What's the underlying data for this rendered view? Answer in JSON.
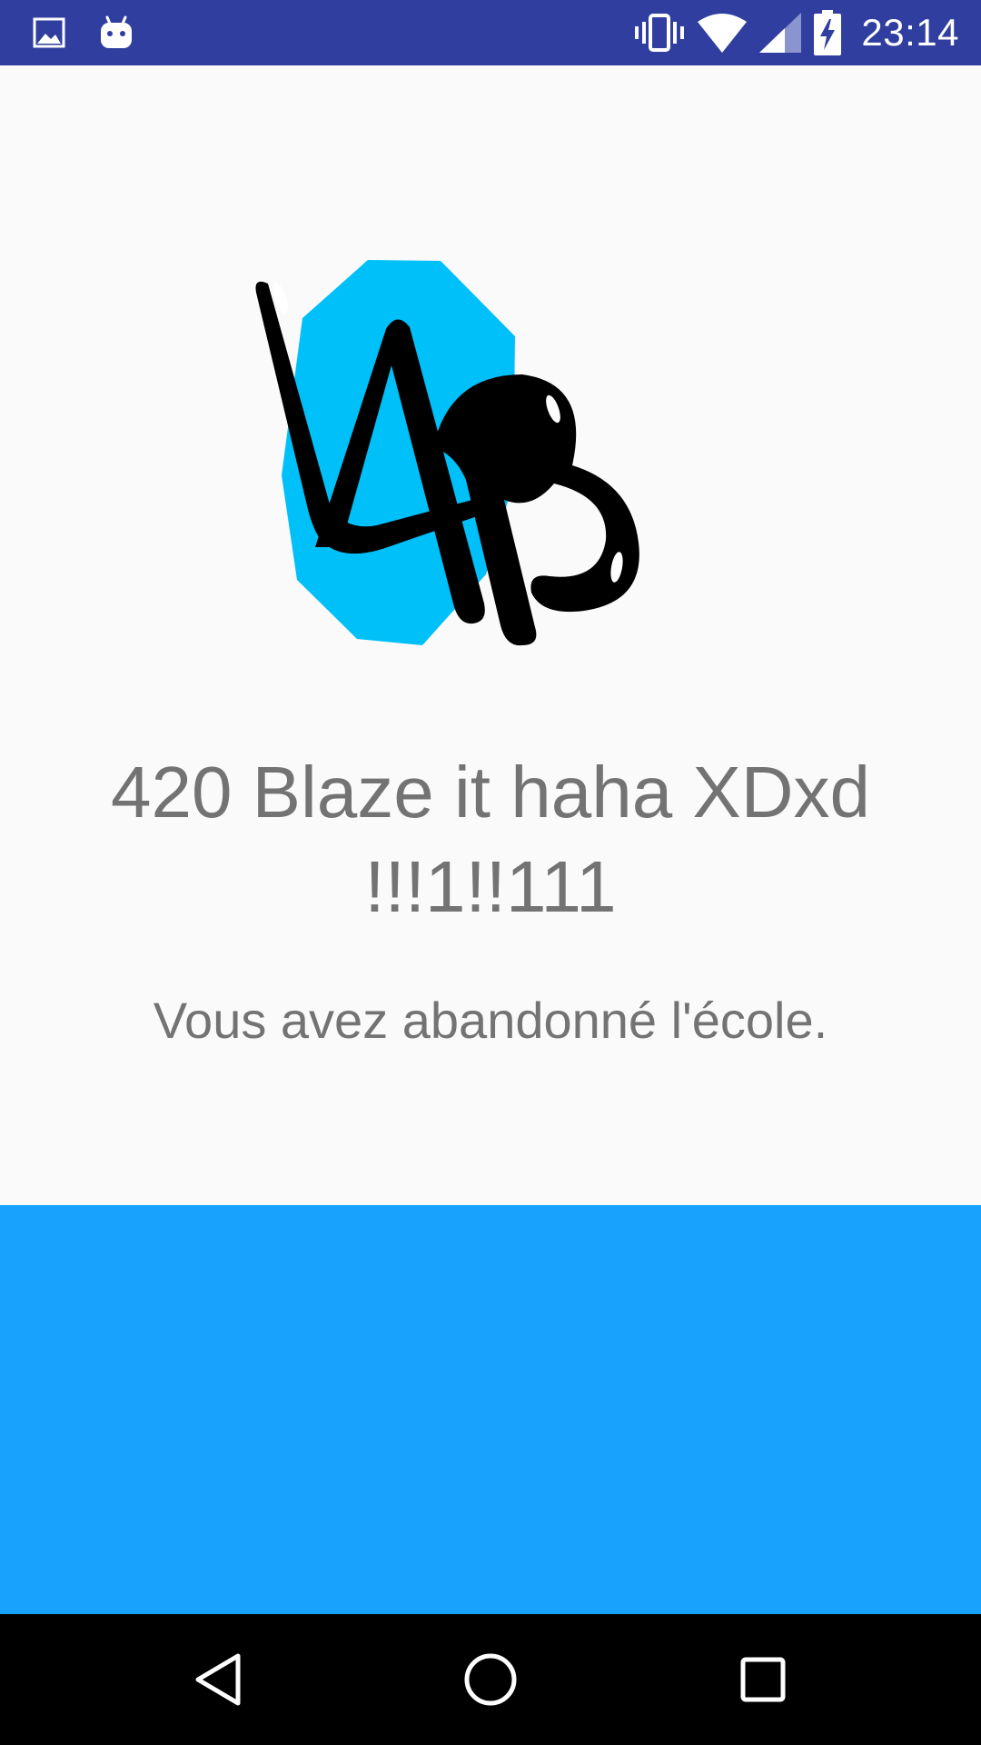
{
  "status_bar": {
    "time": "23:14",
    "left_icons": [
      "image-notification-icon",
      "android-notification-icon"
    ],
    "right_icons": [
      "vibrate-icon",
      "wifi-icon",
      "signal-icon",
      "battery-charging-icon"
    ],
    "background_color": "#303f9f"
  },
  "main": {
    "logo_text": "LAB",
    "title": "420 Blaze it haha XDxd !!!1!!111",
    "subtitle": "Vous avez abandonné l'école.",
    "text_color": "#737373",
    "logo_accent_color": "#00c0f9"
  },
  "panel": {
    "color": "#16a2fd"
  },
  "nav_bar": {
    "buttons": [
      "back-icon",
      "home-icon",
      "recents-icon"
    ]
  }
}
